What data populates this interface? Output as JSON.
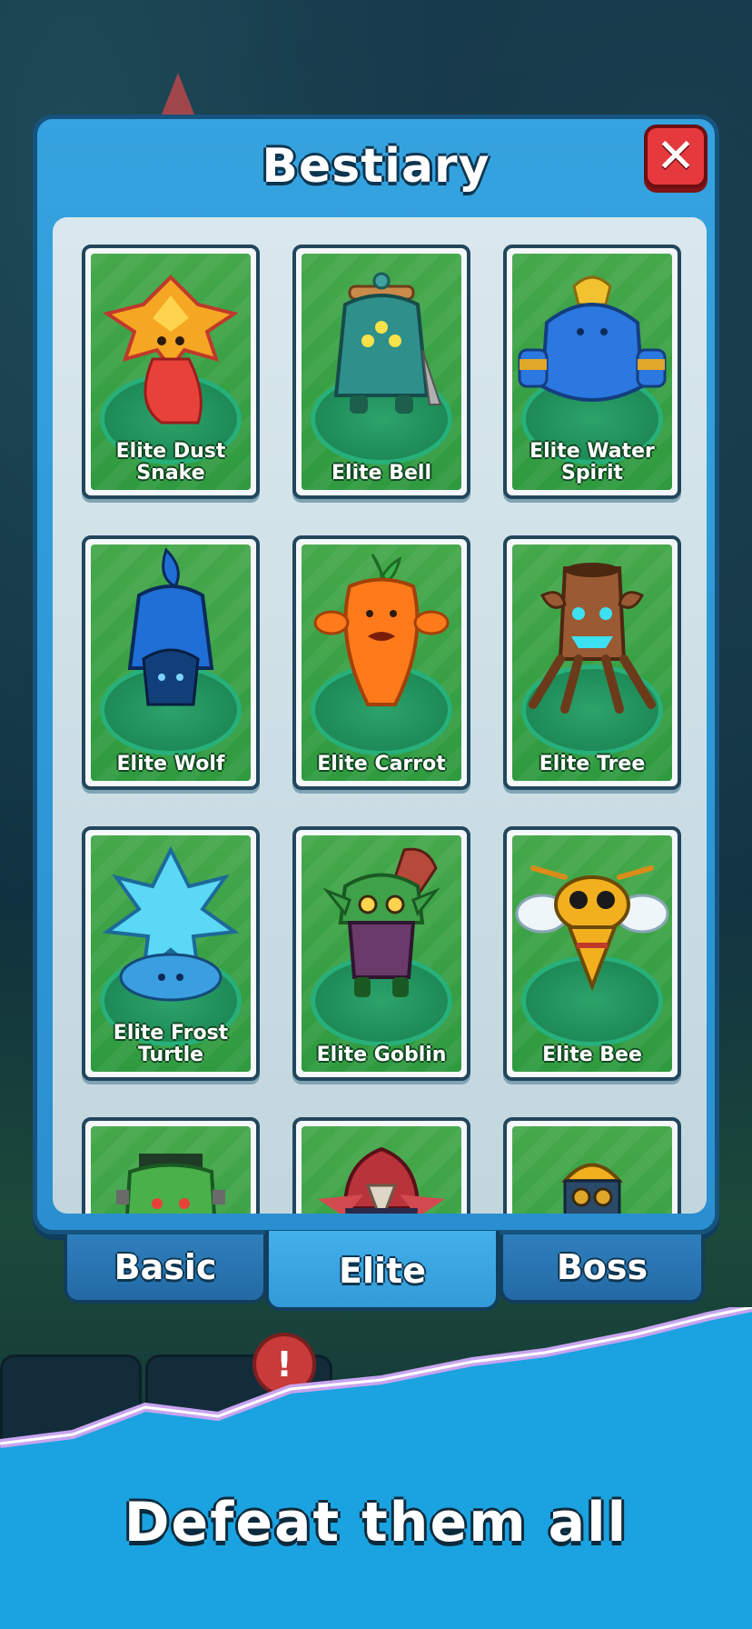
{
  "panel": {
    "title": "Bestiary",
    "close_icon": "close-x-icon"
  },
  "cards": [
    {
      "label": "Elite Dust\nSnake",
      "icon": "dust-snake"
    },
    {
      "label": "Elite Bell",
      "icon": "bell"
    },
    {
      "label": "Elite Water\nSpirit",
      "icon": "water-spirit"
    },
    {
      "label": "Elite Wolf",
      "icon": "wolf"
    },
    {
      "label": "Elite Carrot",
      "icon": "carrot"
    },
    {
      "label": "Elite Tree",
      "icon": "tree"
    },
    {
      "label": "Elite Frost\nTurtle",
      "icon": "frost-turtle"
    },
    {
      "label": "Elite Goblin",
      "icon": "goblin"
    },
    {
      "label": "Elite Bee",
      "icon": "bee"
    },
    {
      "label": "",
      "icon": "frankenstein"
    },
    {
      "label": "",
      "icon": "hooded-crow"
    },
    {
      "label": "",
      "icon": "miner"
    }
  ],
  "tabs": [
    {
      "label": "Basic",
      "active": false
    },
    {
      "label": "Elite",
      "active": true
    },
    {
      "label": "Boss",
      "active": false
    }
  ],
  "background": {
    "alert_text": "!"
  },
  "banner": {
    "text": "Defeat them all"
  },
  "colors": {
    "panel_blue": "#2a8fd0",
    "card_green": "#2f9a3f",
    "close_red": "#e6393e",
    "banner_blue": "#1aa3e0"
  }
}
